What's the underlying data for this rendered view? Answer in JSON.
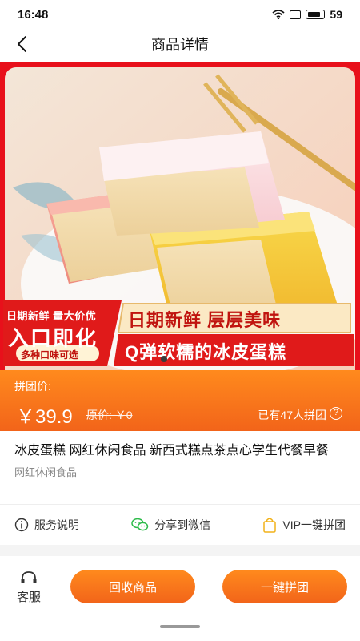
{
  "status_bar": {
    "time": "16:48",
    "battery": "59"
  },
  "nav": {
    "title": "商品详情"
  },
  "banner": {
    "promo_tag": "日期新鲜 量大价优",
    "promo_headline": "入口即化",
    "promo_pill": "多种口味可选",
    "slogan_1": "日期新鲜 层层美味",
    "slogan_2": "Q弹软糯的冰皮蛋糕"
  },
  "price": {
    "label": "拼团价:",
    "value": "￥39.9",
    "original": "原价: ￥0",
    "group_count": "已有47人拼团"
  },
  "product": {
    "title": "冰皮蛋糕 网红休闲食品 新西式糕点茶点心学生代餐早餐",
    "subtitle": "网红休闲食品"
  },
  "services": [
    {
      "label": "服务说明",
      "icon": "info-icon"
    },
    {
      "label": "分享到微信",
      "icon": "wechat-icon"
    },
    {
      "label": "VIP一键拼团",
      "icon": "shopping-bag-icon"
    }
  ],
  "bottom": {
    "kefu_label": "客服",
    "recycle_button": "回收商品",
    "group_button": "一键拼团"
  },
  "colors": {
    "accent": "#f2641a",
    "banner_red": "#e8101b"
  }
}
